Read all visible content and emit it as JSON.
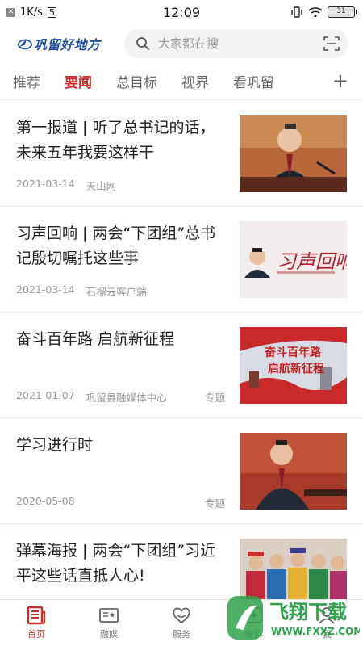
{
  "status_bar": {
    "speed": "1K/s",
    "time": "12:09",
    "battery": "31"
  },
  "header": {
    "logo_text": "巩留好地方",
    "search_placeholder": "大家都在搜"
  },
  "tabs": [
    {
      "label": "推荐"
    },
    {
      "label": "要闻"
    },
    {
      "label": "总目标"
    },
    {
      "label": "视界"
    },
    {
      "label": "看巩留"
    }
  ],
  "tab_add": "+",
  "news": [
    {
      "title": "第一报道 | 听了总书记的话，未来五年我要这样干",
      "date": "2021-03-14",
      "source": "天山网",
      "tag": ""
    },
    {
      "title": "习声回响 | 两会“下团组”总书记殷切嘱托这些事",
      "date": "2021-03-14",
      "source": "石榴云客户端",
      "tag": ""
    },
    {
      "title": "奋斗百年路 启航新征程",
      "date": "2021-01-07",
      "source": "巩留县融媒体中心",
      "tag": "专题"
    },
    {
      "title": "学习进行时",
      "date": "2020-05-08",
      "source": "",
      "tag": "专题"
    },
    {
      "title": "弹幕海报 | 两会“下团组”习近平这些话直抵人心!",
      "date": "",
      "source": "",
      "tag": ""
    }
  ],
  "thumb_texts": {
    "banner_line1": "奋斗百年路",
    "banner_line2": "启航新征程"
  },
  "bottom_nav": [
    {
      "label": "首页",
      "icon": "news-icon"
    },
    {
      "label": "融媒",
      "icon": "media-card-icon"
    },
    {
      "label": "服务",
      "icon": "heart-hands-icon"
    },
    {
      "label": "报料",
      "icon": "report-icon"
    },
    {
      "label": "我",
      "icon": "user-icon"
    }
  ],
  "watermark": {
    "text": "飞翔下载",
    "url": "WWW.FXXZ.COM"
  },
  "colors": {
    "accent": "#c9302c",
    "logo_blue": "#1d4f9c"
  }
}
